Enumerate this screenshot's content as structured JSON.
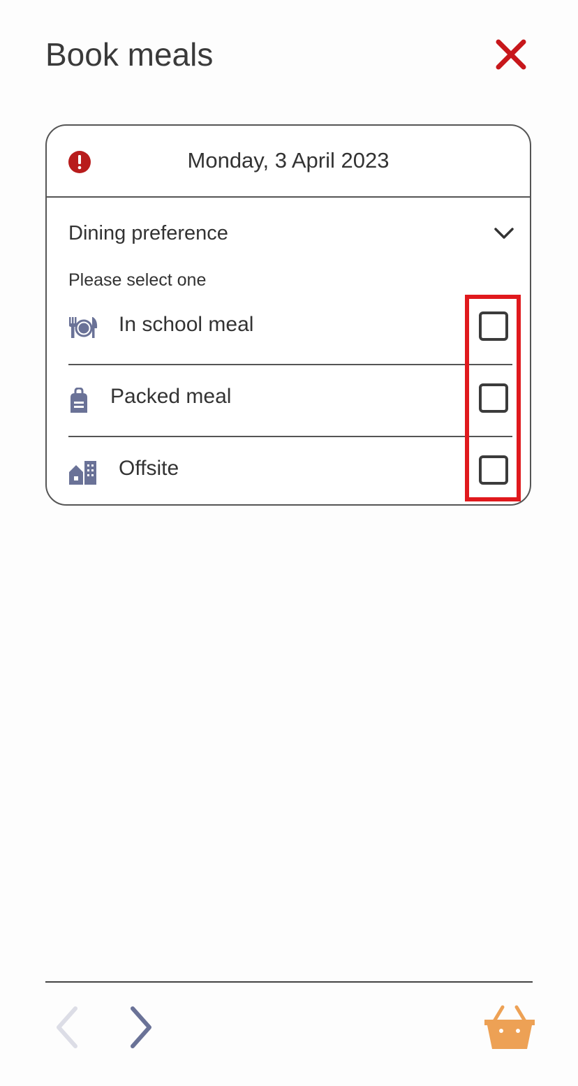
{
  "header": {
    "title": "Book meals",
    "close_icon": "close-icon",
    "close_color": "#c7171b"
  },
  "card": {
    "date": "Monday, 3 April 2023",
    "alert_icon": "alert-circle-icon",
    "alert_color": "#b81c1c",
    "section_title": "Dining preference",
    "section_expanded": true,
    "hint": "Please select one",
    "options": [
      {
        "label": "In school meal",
        "icon": "plate-cutlery-icon",
        "checked": false
      },
      {
        "label": "Packed meal",
        "icon": "lunch-bag-icon",
        "checked": false
      },
      {
        "label": "Offsite",
        "icon": "buildings-icon",
        "checked": false
      }
    ]
  },
  "footer": {
    "prev_icon": "chevron-left-icon",
    "prev_enabled": false,
    "next_icon": "chevron-right-icon",
    "next_enabled": true,
    "basket_icon": "basket-icon",
    "basket_color": "#eda155"
  },
  "colors": {
    "icon_accent": "#6a7297",
    "highlight": "#e0191d",
    "text": "#333333"
  }
}
